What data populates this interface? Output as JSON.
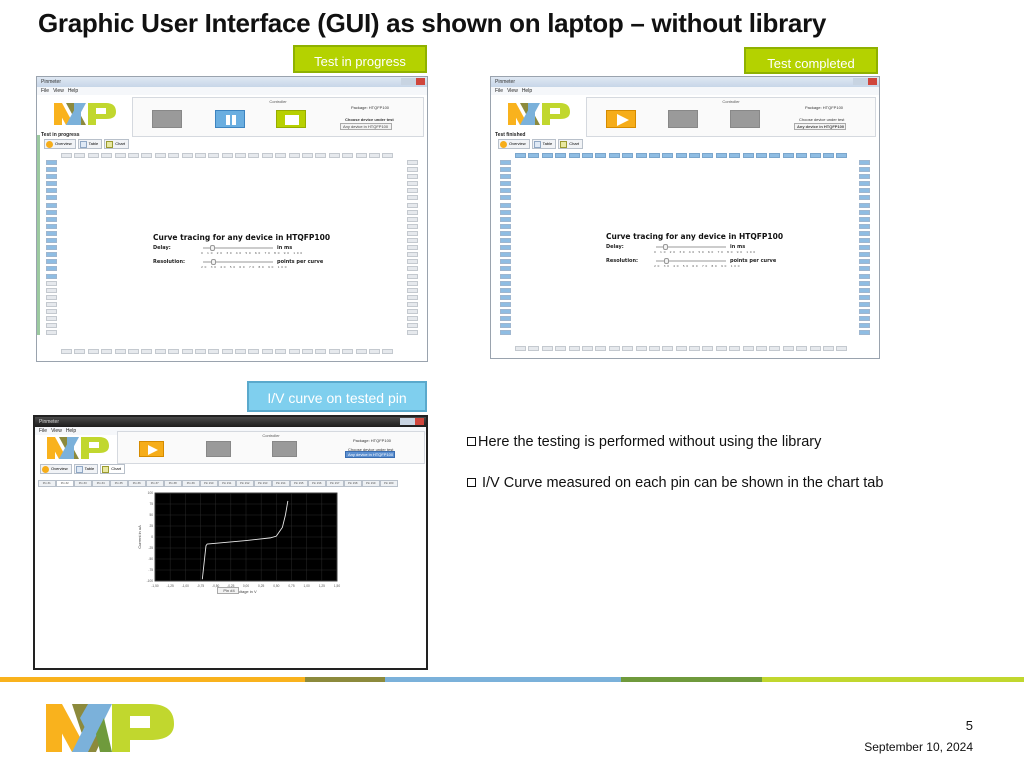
{
  "slide": {
    "title": "Graphic User Interface (GUI) as shown on laptop – without library",
    "badges": {
      "in_progress": "Test in progress",
      "completed": "Test completed",
      "iv_curve": "I/V curve on tested pin"
    },
    "bullets": [
      "Here the testing is performed without using the library",
      "I/V Curve measured on each pin can be shown in the chart tab"
    ],
    "page_number": "5",
    "date": "September 10, 2024",
    "brand_colors": {
      "orange": "#f9b21d",
      "olive": "#8c8a3c",
      "blue": "#7bb1da",
      "green": "#6f9a3c",
      "lime": "#c1d72e"
    }
  },
  "app": {
    "window_title": "Pinmeter",
    "menu": [
      "File",
      "View",
      "Help"
    ],
    "controller_label": "Controller",
    "package_label": "Package: HTQFP100",
    "choose_label": "Choose device under test",
    "tabs": [
      "Overview",
      "Table",
      "Chart"
    ],
    "curve_heading": "Curve tracing for any device in HTQFP100",
    "delay_label": "Delay:",
    "delay_unit": "in ms",
    "delay_ticks": "0 10 20 30 40 50 60 70 80 90 100",
    "resolution_label": "Resolution:",
    "resolution_unit": "points per curve",
    "resolution_ticks": "20 30 40 50 60 70 80 90 100"
  },
  "screenshots": {
    "in_progress": {
      "status": "Test in progress",
      "device_select": "Any device in HTQFP100",
      "controls": [
        "start-disabled",
        "pause",
        "stop"
      ],
      "delay_value": 10,
      "resolution_value": 30
    },
    "completed": {
      "status": "Test finished",
      "device_select": "Any device in HTQFP100",
      "controls": [
        "start",
        "pause-disabled",
        "stop-disabled"
      ],
      "delay_value": 10,
      "resolution_value": 30
    },
    "chart": {
      "device_select": "Any device in HTQFP100",
      "active_tab": "Chart",
      "pin_tabs": [
        "Pin #1",
        "Pin #2",
        "Pin #3",
        "Pin #4",
        "Pin #5",
        "Pin #6",
        "Pin #7",
        "Pin #8",
        "Pin #9",
        "Pin #10",
        "Pin #11",
        "Pin #12",
        "Pin #13",
        "Pin #14",
        "Pin #15",
        "Pin #16",
        "Pin #17",
        "Pin #18",
        "Pin #19",
        "Pin #20"
      ],
      "active_pin_tab": "Pin #2",
      "pin_selector": "Pin #4"
    }
  },
  "chart_data": {
    "type": "line",
    "title": "",
    "xlabel": "Voltage in V",
    "ylabel": "Current in uA",
    "xlim": [
      -1.5,
      1.5
    ],
    "ylim": [
      -100,
      100
    ],
    "x_ticks": [
      "-1,50",
      "-1,25",
      "-1,00",
      "-0,75",
      "-0,50",
      "-0,25",
      "0,00",
      "0,25",
      "0,50",
      "0,75",
      "1,00",
      "1,25",
      "1,50"
    ],
    "y_ticks": [
      "100",
      "75",
      "50",
      "25",
      "0",
      "-25",
      "-50",
      "-75",
      "-100"
    ],
    "grid": true,
    "series": [
      {
        "name": "I/V curve",
        "x": [
          -0.72,
          -0.66,
          -0.64,
          0.0,
          0.4,
          0.5,
          0.6,
          0.65,
          0.69
        ],
        "y": [
          -96,
          -20,
          -16,
          -8,
          -2,
          2,
          22,
          50,
          82
        ]
      }
    ]
  }
}
